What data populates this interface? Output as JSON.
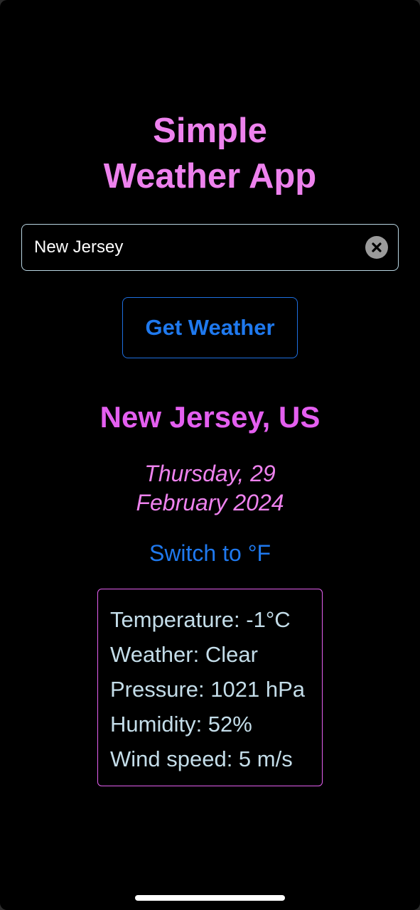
{
  "app": {
    "title_line1": "Simple",
    "title_line2": "Weather App"
  },
  "search": {
    "value": "New Jersey",
    "placeholder": ""
  },
  "actions": {
    "get_weather_label": "Get Weather",
    "switch_unit_label": "Switch to °F"
  },
  "result": {
    "location": "New Jersey, US",
    "date_line1": "Thursday, 29",
    "date_line2": "February 2024",
    "details": [
      "Temperature: -1°C",
      "Weather: Clear",
      "Pressure: 1021 hPa",
      "Humidity: 52%",
      "Wind speed: 5 m/s"
    ]
  },
  "icons": {
    "clear": "close-circle-icon"
  },
  "colors": {
    "background": "#000000",
    "title": "#ee82ee",
    "accent_blue": "#1f79ee",
    "location": "#e45ff0",
    "detail_text": "#c4dde9"
  }
}
